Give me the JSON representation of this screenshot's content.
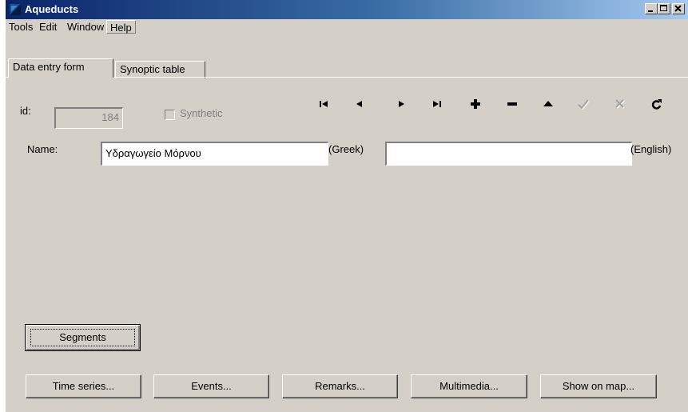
{
  "window": {
    "title": "Aqueducts"
  },
  "menu": {
    "items": [
      "Tools",
      "Edit",
      "Window",
      "Help"
    ]
  },
  "tabs": [
    "Data entry form",
    "Synoptic table"
  ],
  "form": {
    "id_label": "id:",
    "id_value": "184",
    "synthetic_label": "Synthetic",
    "name_label": "Name:",
    "name_greek_value": "Υδραγωγείο Μόρνου",
    "greek_suffix": "(Greek)",
    "name_english_value": "",
    "english_suffix": "(English)"
  },
  "navigator": {
    "buttons": [
      "first-icon",
      "prior-icon",
      "next-icon",
      "last-icon",
      "insert-icon",
      "delete-icon",
      "edit-icon",
      "post-icon",
      "cancel-icon",
      "refresh-icon"
    ]
  },
  "buttons": {
    "segments": "Segments",
    "time_series": "Time series...",
    "events": "Events...",
    "remarks": "Remarks...",
    "multimedia": "Multimedia...",
    "show_on_map": "Show on map..."
  },
  "colors": {
    "title_start": "#0a246a",
    "title_end": "#a6caf0",
    "face": "#d4d0c8"
  }
}
